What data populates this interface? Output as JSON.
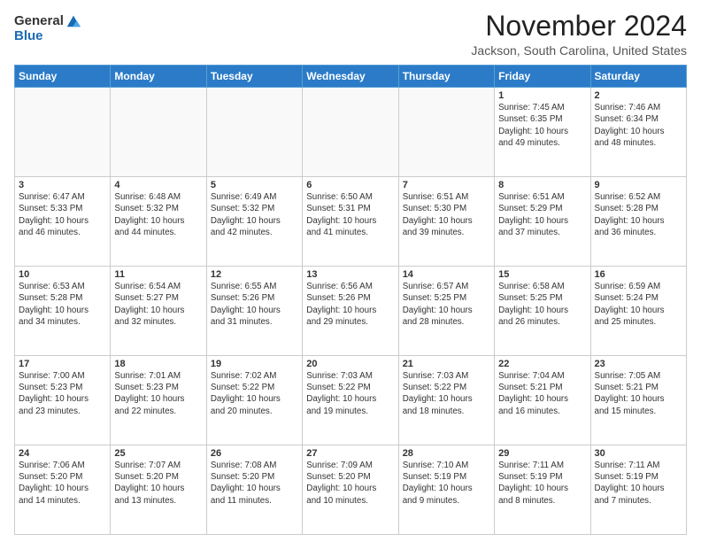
{
  "logo": {
    "general": "General",
    "blue": "Blue"
  },
  "title": "November 2024",
  "location": "Jackson, South Carolina, United States",
  "weekdays": [
    "Sunday",
    "Monday",
    "Tuesday",
    "Wednesday",
    "Thursday",
    "Friday",
    "Saturday"
  ],
  "weeks": [
    [
      {
        "day": "",
        "info": ""
      },
      {
        "day": "",
        "info": ""
      },
      {
        "day": "",
        "info": ""
      },
      {
        "day": "",
        "info": ""
      },
      {
        "day": "",
        "info": ""
      },
      {
        "day": "1",
        "info": "Sunrise: 7:45 AM\nSunset: 6:35 PM\nDaylight: 10 hours\nand 49 minutes."
      },
      {
        "day": "2",
        "info": "Sunrise: 7:46 AM\nSunset: 6:34 PM\nDaylight: 10 hours\nand 48 minutes."
      }
    ],
    [
      {
        "day": "3",
        "info": "Sunrise: 6:47 AM\nSunset: 5:33 PM\nDaylight: 10 hours\nand 46 minutes."
      },
      {
        "day": "4",
        "info": "Sunrise: 6:48 AM\nSunset: 5:32 PM\nDaylight: 10 hours\nand 44 minutes."
      },
      {
        "day": "5",
        "info": "Sunrise: 6:49 AM\nSunset: 5:32 PM\nDaylight: 10 hours\nand 42 minutes."
      },
      {
        "day": "6",
        "info": "Sunrise: 6:50 AM\nSunset: 5:31 PM\nDaylight: 10 hours\nand 41 minutes."
      },
      {
        "day": "7",
        "info": "Sunrise: 6:51 AM\nSunset: 5:30 PM\nDaylight: 10 hours\nand 39 minutes."
      },
      {
        "day": "8",
        "info": "Sunrise: 6:51 AM\nSunset: 5:29 PM\nDaylight: 10 hours\nand 37 minutes."
      },
      {
        "day": "9",
        "info": "Sunrise: 6:52 AM\nSunset: 5:28 PM\nDaylight: 10 hours\nand 36 minutes."
      }
    ],
    [
      {
        "day": "10",
        "info": "Sunrise: 6:53 AM\nSunset: 5:28 PM\nDaylight: 10 hours\nand 34 minutes."
      },
      {
        "day": "11",
        "info": "Sunrise: 6:54 AM\nSunset: 5:27 PM\nDaylight: 10 hours\nand 32 minutes."
      },
      {
        "day": "12",
        "info": "Sunrise: 6:55 AM\nSunset: 5:26 PM\nDaylight: 10 hours\nand 31 minutes."
      },
      {
        "day": "13",
        "info": "Sunrise: 6:56 AM\nSunset: 5:26 PM\nDaylight: 10 hours\nand 29 minutes."
      },
      {
        "day": "14",
        "info": "Sunrise: 6:57 AM\nSunset: 5:25 PM\nDaylight: 10 hours\nand 28 minutes."
      },
      {
        "day": "15",
        "info": "Sunrise: 6:58 AM\nSunset: 5:25 PM\nDaylight: 10 hours\nand 26 minutes."
      },
      {
        "day": "16",
        "info": "Sunrise: 6:59 AM\nSunset: 5:24 PM\nDaylight: 10 hours\nand 25 minutes."
      }
    ],
    [
      {
        "day": "17",
        "info": "Sunrise: 7:00 AM\nSunset: 5:23 PM\nDaylight: 10 hours\nand 23 minutes."
      },
      {
        "day": "18",
        "info": "Sunrise: 7:01 AM\nSunset: 5:23 PM\nDaylight: 10 hours\nand 22 minutes."
      },
      {
        "day": "19",
        "info": "Sunrise: 7:02 AM\nSunset: 5:22 PM\nDaylight: 10 hours\nand 20 minutes."
      },
      {
        "day": "20",
        "info": "Sunrise: 7:03 AM\nSunset: 5:22 PM\nDaylight: 10 hours\nand 19 minutes."
      },
      {
        "day": "21",
        "info": "Sunrise: 7:03 AM\nSunset: 5:22 PM\nDaylight: 10 hours\nand 18 minutes."
      },
      {
        "day": "22",
        "info": "Sunrise: 7:04 AM\nSunset: 5:21 PM\nDaylight: 10 hours\nand 16 minutes."
      },
      {
        "day": "23",
        "info": "Sunrise: 7:05 AM\nSunset: 5:21 PM\nDaylight: 10 hours\nand 15 minutes."
      }
    ],
    [
      {
        "day": "24",
        "info": "Sunrise: 7:06 AM\nSunset: 5:20 PM\nDaylight: 10 hours\nand 14 minutes."
      },
      {
        "day": "25",
        "info": "Sunrise: 7:07 AM\nSunset: 5:20 PM\nDaylight: 10 hours\nand 13 minutes."
      },
      {
        "day": "26",
        "info": "Sunrise: 7:08 AM\nSunset: 5:20 PM\nDaylight: 10 hours\nand 11 minutes."
      },
      {
        "day": "27",
        "info": "Sunrise: 7:09 AM\nSunset: 5:20 PM\nDaylight: 10 hours\nand 10 minutes."
      },
      {
        "day": "28",
        "info": "Sunrise: 7:10 AM\nSunset: 5:19 PM\nDaylight: 10 hours\nand 9 minutes."
      },
      {
        "day": "29",
        "info": "Sunrise: 7:11 AM\nSunset: 5:19 PM\nDaylight: 10 hours\nand 8 minutes."
      },
      {
        "day": "30",
        "info": "Sunrise: 7:11 AM\nSunset: 5:19 PM\nDaylight: 10 hours\nand 7 minutes."
      }
    ]
  ]
}
